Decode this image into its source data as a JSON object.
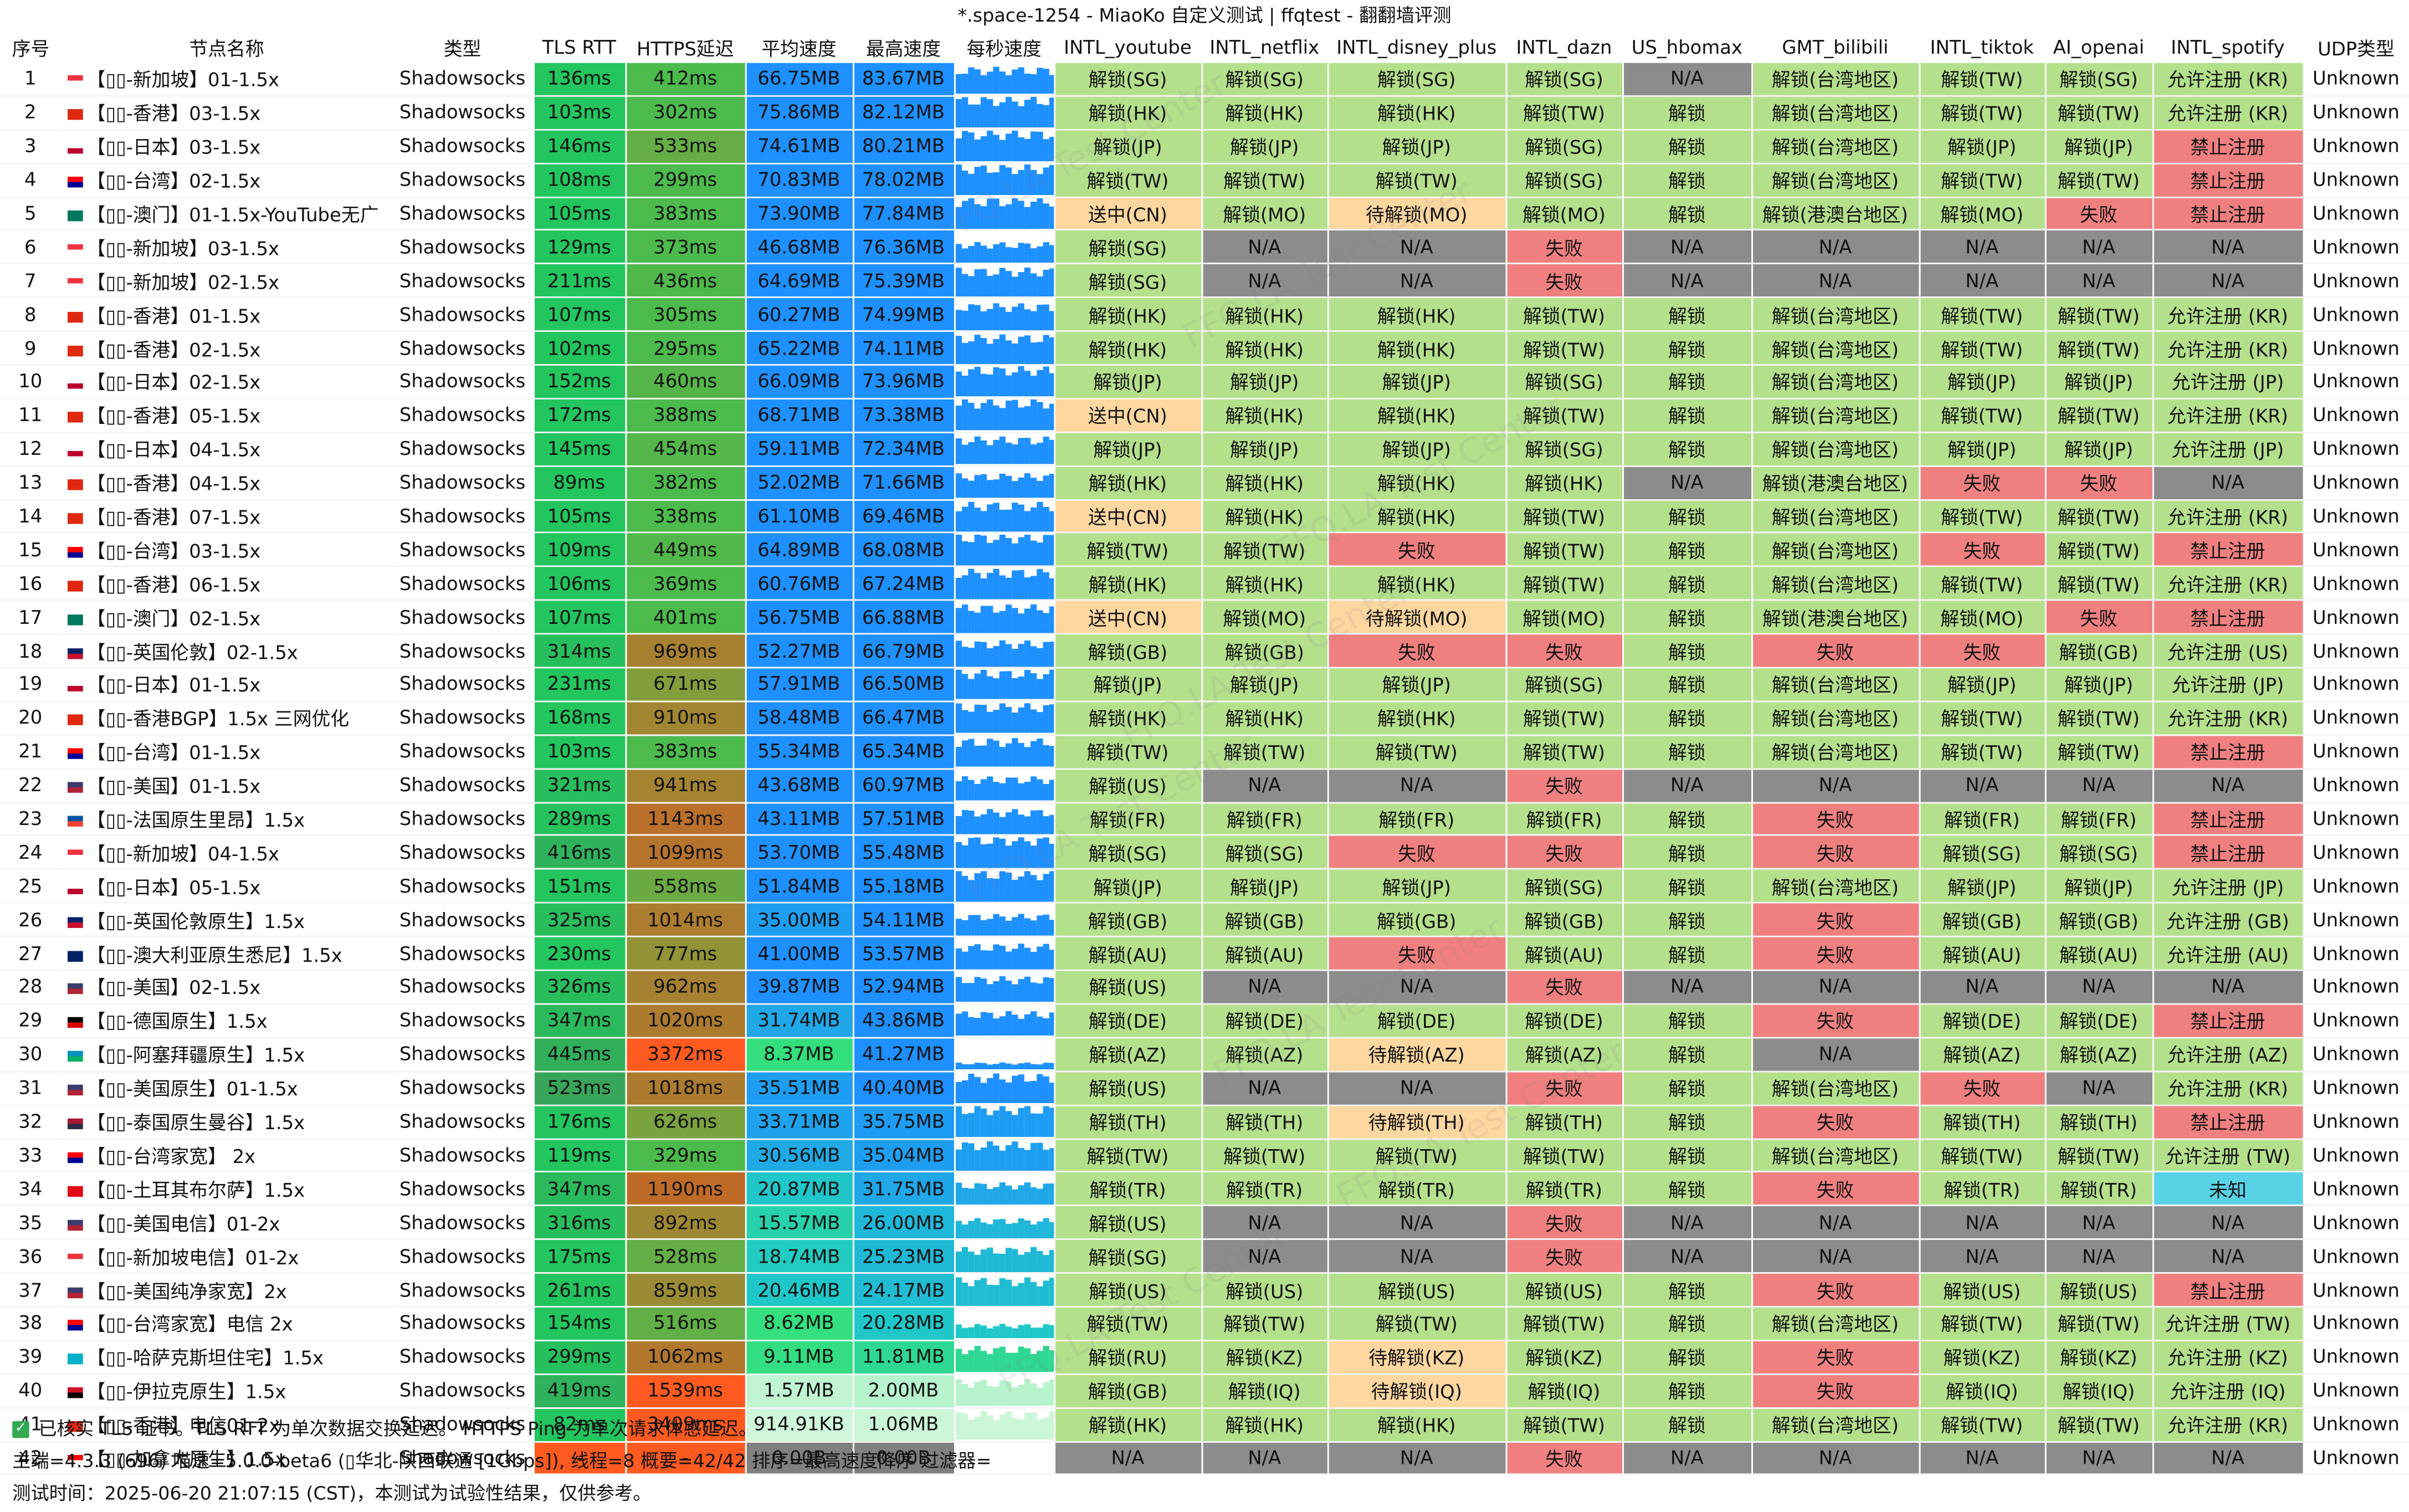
{
  "title": "*.space-1254 - MiaoKo 自定义测试 | ffqtest - 翻翻墙评测",
  "headers": [
    "序号",
    "节点名称",
    "类型",
    "TLS RTT",
    "HTTPS延迟",
    "平均速度",
    "最高速度",
    "每秒速度",
    "INTL_youtube",
    "INTL_netflix",
    "INTL_disney_plus",
    "INTL_dazn",
    "US_hbomax",
    "GMT_bilibili",
    "INTL_tiktok",
    "AI_openai",
    "INTL_spotify",
    "UDP类型"
  ],
  "watermark": "FFQ.LA Test Center",
  "rows": [
    {
      "n": "1",
      "flag": "sg",
      "name": "【▯▯-新加坡】01-1.5x",
      "type": "Shadowsocks",
      "tls": "136ms",
      "https": "412ms",
      "avg": "66.75MB",
      "max": "83.67MB",
      "yt": "解锁(SG)",
      "nf": "解锁(SG)",
      "dp": "解锁(SG)",
      "dz": "解锁(SG)",
      "hbo": "N/A",
      "bili": "解锁(台湾地区)",
      "tt": "解锁(TW)",
      "ai": "解锁(SG)",
      "sp": "允许注册 (KR)",
      "udp": "Unknown"
    },
    {
      "n": "2",
      "flag": "hk",
      "name": "【▯▯-香港】03-1.5x",
      "type": "Shadowsocks",
      "tls": "103ms",
      "https": "302ms",
      "avg": "75.86MB",
      "max": "82.12MB",
      "yt": "解锁(HK)",
      "nf": "解锁(HK)",
      "dp": "解锁(HK)",
      "dz": "解锁(TW)",
      "hbo": "解锁",
      "bili": "解锁(台湾地区)",
      "tt": "解锁(TW)",
      "ai": "解锁(TW)",
      "sp": "允许注册 (KR)",
      "udp": "Unknown"
    },
    {
      "n": "3",
      "flag": "jp",
      "name": "【▯▯-日本】03-1.5x",
      "type": "Shadowsocks",
      "tls": "146ms",
      "https": "533ms",
      "avg": "74.61MB",
      "max": "80.21MB",
      "yt": "解锁(JP)",
      "nf": "解锁(JP)",
      "dp": "解锁(JP)",
      "dz": "解锁(SG)",
      "hbo": "解锁",
      "bili": "解锁(台湾地区)",
      "tt": "解锁(JP)",
      "ai": "解锁(JP)",
      "sp": "禁止注册",
      "udp": "Unknown"
    },
    {
      "n": "4",
      "flag": "tw",
      "name": "【▯▯-台湾】02-1.5x",
      "type": "Shadowsocks",
      "tls": "108ms",
      "https": "299ms",
      "avg": "70.83MB",
      "max": "78.02MB",
      "yt": "解锁(TW)",
      "nf": "解锁(TW)",
      "dp": "解锁(TW)",
      "dz": "解锁(SG)",
      "hbo": "解锁",
      "bili": "解锁(台湾地区)",
      "tt": "解锁(TW)",
      "ai": "解锁(TW)",
      "sp": "禁止注册",
      "udp": "Unknown"
    },
    {
      "n": "5",
      "flag": "mo",
      "name": "【▯▯-澳门】01-1.5x-YouTube无广",
      "type": "Shadowsocks",
      "tls": "105ms",
      "https": "383ms",
      "avg": "73.90MB",
      "max": "77.84MB",
      "yt": "送中(CN)",
      "nf": "解锁(MO)",
      "dp": "待解锁(MO)",
      "dz": "解锁(MO)",
      "hbo": "解锁",
      "bili": "解锁(港澳台地区)",
      "tt": "解锁(MO)",
      "ai": "失败",
      "sp": "禁止注册",
      "udp": "Unknown"
    },
    {
      "n": "6",
      "flag": "sg",
      "name": "【▯▯-新加坡】03-1.5x",
      "type": "Shadowsocks",
      "tls": "129ms",
      "https": "373ms",
      "avg": "46.68MB",
      "max": "76.36MB",
      "yt": "解锁(SG)",
      "nf": "N/A",
      "dp": "N/A",
      "dz": "失败",
      "hbo": "N/A",
      "bili": "N/A",
      "tt": "N/A",
      "ai": "N/A",
      "sp": "N/A",
      "udp": "Unknown"
    },
    {
      "n": "7",
      "flag": "sg",
      "name": "【▯▯-新加坡】02-1.5x",
      "type": "Shadowsocks",
      "tls": "211ms",
      "https": "436ms",
      "avg": "64.69MB",
      "max": "75.39MB",
      "yt": "解锁(SG)",
      "nf": "N/A",
      "dp": "N/A",
      "dz": "失败",
      "hbo": "N/A",
      "bili": "N/A",
      "tt": "N/A",
      "ai": "N/A",
      "sp": "N/A",
      "udp": "Unknown"
    },
    {
      "n": "8",
      "flag": "hk",
      "name": "【▯▯-香港】01-1.5x",
      "type": "Shadowsocks",
      "tls": "107ms",
      "https": "305ms",
      "avg": "60.27MB",
      "max": "74.99MB",
      "yt": "解锁(HK)",
      "nf": "解锁(HK)",
      "dp": "解锁(HK)",
      "dz": "解锁(TW)",
      "hbo": "解锁",
      "bili": "解锁(台湾地区)",
      "tt": "解锁(TW)",
      "ai": "解锁(TW)",
      "sp": "允许注册 (KR)",
      "udp": "Unknown"
    },
    {
      "n": "9",
      "flag": "hk",
      "name": "【▯▯-香港】02-1.5x",
      "type": "Shadowsocks",
      "tls": "102ms",
      "https": "295ms",
      "avg": "65.22MB",
      "max": "74.11MB",
      "yt": "解锁(HK)",
      "nf": "解锁(HK)",
      "dp": "解锁(HK)",
      "dz": "解锁(TW)",
      "hbo": "解锁",
      "bili": "解锁(台湾地区)",
      "tt": "解锁(TW)",
      "ai": "解锁(TW)",
      "sp": "允许注册 (KR)",
      "udp": "Unknown"
    },
    {
      "n": "10",
      "flag": "jp",
      "name": "【▯▯-日本】02-1.5x",
      "type": "Shadowsocks",
      "tls": "152ms",
      "https": "460ms",
      "avg": "66.09MB",
      "max": "73.96MB",
      "yt": "解锁(JP)",
      "nf": "解锁(JP)",
      "dp": "解锁(JP)",
      "dz": "解锁(SG)",
      "hbo": "解锁",
      "bili": "解锁(台湾地区)",
      "tt": "解锁(JP)",
      "ai": "解锁(JP)",
      "sp": "允许注册 (JP)",
      "udp": "Unknown"
    },
    {
      "n": "11",
      "flag": "hk",
      "name": "【▯▯-香港】05-1.5x",
      "type": "Shadowsocks",
      "tls": "172ms",
      "https": "388ms",
      "avg": "68.71MB",
      "max": "73.38MB",
      "yt": "送中(CN)",
      "nf": "解锁(HK)",
      "dp": "解锁(HK)",
      "dz": "解锁(TW)",
      "hbo": "解锁",
      "bili": "解锁(台湾地区)",
      "tt": "解锁(TW)",
      "ai": "解锁(TW)",
      "sp": "允许注册 (KR)",
      "udp": "Unknown"
    },
    {
      "n": "12",
      "flag": "jp",
      "name": "【▯▯-日本】04-1.5x",
      "type": "Shadowsocks",
      "tls": "145ms",
      "https": "454ms",
      "avg": "59.11MB",
      "max": "72.34MB",
      "yt": "解锁(JP)",
      "nf": "解锁(JP)",
      "dp": "解锁(JP)",
      "dz": "解锁(SG)",
      "hbo": "解锁",
      "bili": "解锁(台湾地区)",
      "tt": "解锁(JP)",
      "ai": "解锁(JP)",
      "sp": "允许注册 (JP)",
      "udp": "Unknown"
    },
    {
      "n": "13",
      "flag": "hk",
      "name": "【▯▯-香港】04-1.5x",
      "type": "Shadowsocks",
      "tls": "89ms",
      "https": "382ms",
      "avg": "52.02MB",
      "max": "71.66MB",
      "yt": "解锁(HK)",
      "nf": "解锁(HK)",
      "dp": "解锁(HK)",
      "dz": "解锁(HK)",
      "hbo": "N/A",
      "bili": "解锁(港澳台地区)",
      "tt": "失败",
      "ai": "失败",
      "sp": "N/A",
      "udp": "Unknown"
    },
    {
      "n": "14",
      "flag": "hk",
      "name": "【▯▯-香港】07-1.5x",
      "type": "Shadowsocks",
      "tls": "105ms",
      "https": "338ms",
      "avg": "61.10MB",
      "max": "69.46MB",
      "yt": "送中(CN)",
      "nf": "解锁(HK)",
      "dp": "解锁(HK)",
      "dz": "解锁(TW)",
      "hbo": "解锁",
      "bili": "解锁(台湾地区)",
      "tt": "解锁(TW)",
      "ai": "解锁(TW)",
      "sp": "允许注册 (KR)",
      "udp": "Unknown"
    },
    {
      "n": "15",
      "flag": "tw",
      "name": "【▯▯-台湾】03-1.5x",
      "type": "Shadowsocks",
      "tls": "109ms",
      "https": "449ms",
      "avg": "64.89MB",
      "max": "68.08MB",
      "yt": "解锁(TW)",
      "nf": "解锁(TW)",
      "dp": "失败",
      "dz": "解锁(TW)",
      "hbo": "解锁",
      "bili": "解锁(台湾地区)",
      "tt": "失败",
      "ai": "解锁(TW)",
      "sp": "禁止注册",
      "udp": "Unknown"
    },
    {
      "n": "16",
      "flag": "hk",
      "name": "【▯▯-香港】06-1.5x",
      "type": "Shadowsocks",
      "tls": "106ms",
      "https": "369ms",
      "avg": "60.76MB",
      "max": "67.24MB",
      "yt": "解锁(HK)",
      "nf": "解锁(HK)",
      "dp": "解锁(HK)",
      "dz": "解锁(TW)",
      "hbo": "解锁",
      "bili": "解锁(台湾地区)",
      "tt": "解锁(TW)",
      "ai": "解锁(TW)",
      "sp": "允许注册 (KR)",
      "udp": "Unknown"
    },
    {
      "n": "17",
      "flag": "mo",
      "name": "【▯▯-澳门】02-1.5x",
      "type": "Shadowsocks",
      "tls": "107ms",
      "https": "401ms",
      "avg": "56.75MB",
      "max": "66.88MB",
      "yt": "送中(CN)",
      "nf": "解锁(MO)",
      "dp": "待解锁(MO)",
      "dz": "解锁(MO)",
      "hbo": "解锁",
      "bili": "解锁(港澳台地区)",
      "tt": "解锁(MO)",
      "ai": "失败",
      "sp": "禁止注册",
      "udp": "Unknown"
    },
    {
      "n": "18",
      "flag": "gb",
      "name": "【▯▯-英国伦敦】02-1.5x",
      "type": "Shadowsocks",
      "tls": "314ms",
      "https": "969ms",
      "avg": "52.27MB",
      "max": "66.79MB",
      "yt": "解锁(GB)",
      "nf": "解锁(GB)",
      "dp": "失败",
      "dz": "失败",
      "hbo": "解锁",
      "bili": "失败",
      "tt": "失败",
      "ai": "解锁(GB)",
      "sp": "允许注册 (US)",
      "udp": "Unknown"
    },
    {
      "n": "19",
      "flag": "jp",
      "name": "【▯▯-日本】01-1.5x",
      "type": "Shadowsocks",
      "tls": "231ms",
      "https": "671ms",
      "avg": "57.91MB",
      "max": "66.50MB",
      "yt": "解锁(JP)",
      "nf": "解锁(JP)",
      "dp": "解锁(JP)",
      "dz": "解锁(SG)",
      "hbo": "解锁",
      "bili": "解锁(台湾地区)",
      "tt": "解锁(JP)",
      "ai": "解锁(JP)",
      "sp": "允许注册 (JP)",
      "udp": "Unknown"
    },
    {
      "n": "20",
      "flag": "hk",
      "name": "【▯▯-香港BGP】1.5x 三网优化",
      "type": "Shadowsocks",
      "tls": "168ms",
      "https": "910ms",
      "avg": "58.48MB",
      "max": "66.47MB",
      "yt": "解锁(HK)",
      "nf": "解锁(HK)",
      "dp": "解锁(HK)",
      "dz": "解锁(TW)",
      "hbo": "解锁",
      "bili": "解锁(台湾地区)",
      "tt": "解锁(TW)",
      "ai": "解锁(TW)",
      "sp": "允许注册 (KR)",
      "udp": "Unknown"
    },
    {
      "n": "21",
      "flag": "tw",
      "name": "【▯▯-台湾】01-1.5x",
      "type": "Shadowsocks",
      "tls": "103ms",
      "https": "383ms",
      "avg": "55.34MB",
      "max": "65.34MB",
      "yt": "解锁(TW)",
      "nf": "解锁(TW)",
      "dp": "解锁(TW)",
      "dz": "解锁(TW)",
      "hbo": "解锁",
      "bili": "解锁(台湾地区)",
      "tt": "解锁(TW)",
      "ai": "解锁(TW)",
      "sp": "禁止注册",
      "udp": "Unknown"
    },
    {
      "n": "22",
      "flag": "us",
      "name": "【▯▯-美国】01-1.5x",
      "type": "Shadowsocks",
      "tls": "321ms",
      "https": "941ms",
      "avg": "43.68MB",
      "max": "60.97MB",
      "yt": "解锁(US)",
      "nf": "N/A",
      "dp": "N/A",
      "dz": "失败",
      "hbo": "N/A",
      "bili": "N/A",
      "tt": "N/A",
      "ai": "N/A",
      "sp": "N/A",
      "udp": "Unknown"
    },
    {
      "n": "23",
      "flag": "fr",
      "name": "【▯▯-法国原生里昂】1.5x",
      "type": "Shadowsocks",
      "tls": "289ms",
      "https": "1143ms",
      "avg": "43.11MB",
      "max": "57.51MB",
      "yt": "解锁(FR)",
      "nf": "解锁(FR)",
      "dp": "解锁(FR)",
      "dz": "解锁(FR)",
      "hbo": "解锁",
      "bili": "失败",
      "tt": "解锁(FR)",
      "ai": "解锁(FR)",
      "sp": "禁止注册",
      "udp": "Unknown"
    },
    {
      "n": "24",
      "flag": "sg",
      "name": "【▯▯-新加坡】04-1.5x",
      "type": "Shadowsocks",
      "tls": "416ms",
      "https": "1099ms",
      "avg": "53.70MB",
      "max": "55.48MB",
      "yt": "解锁(SG)",
      "nf": "解锁(SG)",
      "dp": "失败",
      "dz": "失败",
      "hbo": "解锁",
      "bili": "失败",
      "tt": "解锁(SG)",
      "ai": "解锁(SG)",
      "sp": "禁止注册",
      "udp": "Unknown"
    },
    {
      "n": "25",
      "flag": "jp",
      "name": "【▯▯-日本】05-1.5x",
      "type": "Shadowsocks",
      "tls": "151ms",
      "https": "558ms",
      "avg": "51.84MB",
      "max": "55.18MB",
      "yt": "解锁(JP)",
      "nf": "解锁(JP)",
      "dp": "解锁(JP)",
      "dz": "解锁(SG)",
      "hbo": "解锁",
      "bili": "解锁(台湾地区)",
      "tt": "解锁(JP)",
      "ai": "解锁(JP)",
      "sp": "允许注册 (JP)",
      "udp": "Unknown"
    },
    {
      "n": "26",
      "flag": "gb",
      "name": "【▯▯-英国伦敦原生】1.5x",
      "type": "Shadowsocks",
      "tls": "325ms",
      "https": "1014ms",
      "avg": "35.00MB",
      "max": "54.11MB",
      "yt": "解锁(GB)",
      "nf": "解锁(GB)",
      "dp": "解锁(GB)",
      "dz": "解锁(GB)",
      "hbo": "解锁",
      "bili": "失败",
      "tt": "解锁(GB)",
      "ai": "解锁(GB)",
      "sp": "允许注册 (GB)",
      "udp": "Unknown"
    },
    {
      "n": "27",
      "flag": "au",
      "name": "【▯▯-澳大利亚原生悉尼】1.5x",
      "type": "Shadowsocks",
      "tls": "230ms",
      "https": "777ms",
      "avg": "41.00MB",
      "max": "53.57MB",
      "yt": "解锁(AU)",
      "nf": "解锁(AU)",
      "dp": "失败",
      "dz": "解锁(AU)",
      "hbo": "解锁",
      "bili": "失败",
      "tt": "解锁(AU)",
      "ai": "解锁(AU)",
      "sp": "允许注册 (AU)",
      "udp": "Unknown"
    },
    {
      "n": "28",
      "flag": "us",
      "name": "【▯▯-美国】02-1.5x",
      "type": "Shadowsocks",
      "tls": "326ms",
      "https": "962ms",
      "avg": "39.87MB",
      "max": "52.94MB",
      "yt": "解锁(US)",
      "nf": "N/A",
      "dp": "N/A",
      "dz": "失败",
      "hbo": "N/A",
      "bili": "N/A",
      "tt": "N/A",
      "ai": "N/A",
      "sp": "N/A",
      "udp": "Unknown"
    },
    {
      "n": "29",
      "flag": "de",
      "name": "【▯▯-德国原生】1.5x",
      "type": "Shadowsocks",
      "tls": "347ms",
      "https": "1020ms",
      "avg": "31.74MB",
      "max": "43.86MB",
      "yt": "解锁(DE)",
      "nf": "解锁(DE)",
      "dp": "解锁(DE)",
      "dz": "解锁(DE)",
      "hbo": "解锁",
      "bili": "失败",
      "tt": "解锁(DE)",
      "ai": "解锁(DE)",
      "sp": "禁止注册",
      "udp": "Unknown"
    },
    {
      "n": "30",
      "flag": "az",
      "name": "【▯▯-阿塞拜疆原生】1.5x",
      "type": "Shadowsocks",
      "tls": "445ms",
      "https": "3372ms",
      "avg": "8.37MB",
      "max": "41.27MB",
      "yt": "解锁(AZ)",
      "nf": "解锁(AZ)",
      "dp": "待解锁(AZ)",
      "dz": "解锁(AZ)",
      "hbo": "解锁",
      "bili": "N/A",
      "tt": "解锁(AZ)",
      "ai": "解锁(AZ)",
      "sp": "允许注册 (AZ)",
      "udp": "Unknown"
    },
    {
      "n": "31",
      "flag": "us",
      "name": "【▯▯-美国原生】01-1.5x",
      "type": "Shadowsocks",
      "tls": "523ms",
      "https": "1018ms",
      "avg": "35.51MB",
      "max": "40.40MB",
      "yt": "解锁(US)",
      "nf": "N/A",
      "dp": "N/A",
      "dz": "失败",
      "hbo": "解锁",
      "bili": "解锁(台湾地区)",
      "tt": "失败",
      "ai": "N/A",
      "sp": "允许注册 (KR)",
      "udp": "Unknown"
    },
    {
      "n": "32",
      "flag": "th",
      "name": "【▯▯-泰国原生曼谷】1.5x",
      "type": "Shadowsocks",
      "tls": "176ms",
      "https": "626ms",
      "avg": "33.71MB",
      "max": "35.75MB",
      "yt": "解锁(TH)",
      "nf": "解锁(TH)",
      "dp": "待解锁(TH)",
      "dz": "解锁(TH)",
      "hbo": "解锁",
      "bili": "失败",
      "tt": "解锁(TH)",
      "ai": "解锁(TH)",
      "sp": "禁止注册",
      "udp": "Unknown"
    },
    {
      "n": "33",
      "flag": "tw",
      "name": "【▯▯-台湾家宽】 2x",
      "type": "Shadowsocks",
      "tls": "119ms",
      "https": "329ms",
      "avg": "30.56MB",
      "max": "35.04MB",
      "yt": "解锁(TW)",
      "nf": "解锁(TW)",
      "dp": "解锁(TW)",
      "dz": "解锁(TW)",
      "hbo": "解锁",
      "bili": "解锁(台湾地区)",
      "tt": "解锁(TW)",
      "ai": "解锁(TW)",
      "sp": "允许注册 (TW)",
      "udp": "Unknown"
    },
    {
      "n": "34",
      "flag": "tr",
      "name": "【▯▯-土耳其布尔萨】1.5x",
      "type": "Shadowsocks",
      "tls": "347ms",
      "https": "1190ms",
      "avg": "20.87MB",
      "max": "31.75MB",
      "yt": "解锁(TR)",
      "nf": "解锁(TR)",
      "dp": "解锁(TR)",
      "dz": "解锁(TR)",
      "hbo": "解锁",
      "bili": "失败",
      "tt": "解锁(TR)",
      "ai": "解锁(TR)",
      "sp": "未知",
      "udp": "Unknown"
    },
    {
      "n": "35",
      "flag": "us",
      "name": "【▯▯-美国电信】01-2x",
      "type": "Shadowsocks",
      "tls": "316ms",
      "https": "892ms",
      "avg": "15.57MB",
      "max": "26.00MB",
      "yt": "解锁(US)",
      "nf": "N/A",
      "dp": "N/A",
      "dz": "失败",
      "hbo": "N/A",
      "bili": "N/A",
      "tt": "N/A",
      "ai": "N/A",
      "sp": "N/A",
      "udp": "Unknown"
    },
    {
      "n": "36",
      "flag": "sg",
      "name": "【▯▯-新加坡电信】01-2x",
      "type": "Shadowsocks",
      "tls": "175ms",
      "https": "528ms",
      "avg": "18.74MB",
      "max": "25.23MB",
      "yt": "解锁(SG)",
      "nf": "N/A",
      "dp": "N/A",
      "dz": "失败",
      "hbo": "N/A",
      "bili": "N/A",
      "tt": "N/A",
      "ai": "N/A",
      "sp": "N/A",
      "udp": "Unknown"
    },
    {
      "n": "37",
      "flag": "us",
      "name": "【▯▯-美国纯净家宽】2x",
      "type": "Shadowsocks",
      "tls": "261ms",
      "https": "859ms",
      "avg": "20.46MB",
      "max": "24.17MB",
      "yt": "解锁(US)",
      "nf": "解锁(US)",
      "dp": "解锁(US)",
      "dz": "解锁(US)",
      "hbo": "解锁",
      "bili": "失败",
      "tt": "解锁(US)",
      "ai": "解锁(US)",
      "sp": "禁止注册",
      "udp": "Unknown"
    },
    {
      "n": "38",
      "flag": "tw",
      "name": "【▯▯-台湾家宽】电信 2x",
      "type": "Shadowsocks",
      "tls": "154ms",
      "https": "516ms",
      "avg": "8.62MB",
      "max": "20.28MB",
      "yt": "解锁(TW)",
      "nf": "解锁(TW)",
      "dp": "解锁(TW)",
      "dz": "解锁(TW)",
      "hbo": "解锁",
      "bili": "解锁(台湾地区)",
      "tt": "解锁(TW)",
      "ai": "解锁(TW)",
      "sp": "允许注册 (TW)",
      "udp": "Unknown"
    },
    {
      "n": "39",
      "flag": "kz",
      "name": "【▯▯-哈萨克斯坦住宅】1.5x",
      "type": "Shadowsocks",
      "tls": "299ms",
      "https": "1062ms",
      "avg": "9.11MB",
      "max": "11.81MB",
      "yt": "解锁(RU)",
      "nf": "解锁(KZ)",
      "dp": "待解锁(KZ)",
      "dz": "解锁(KZ)",
      "hbo": "解锁",
      "bili": "失败",
      "tt": "解锁(KZ)",
      "ai": "解锁(KZ)",
      "sp": "允许注册 (KZ)",
      "udp": "Unknown"
    },
    {
      "n": "40",
      "flag": "iq",
      "name": "【▯▯-伊拉克原生】1.5x",
      "type": "Shadowsocks",
      "tls": "419ms",
      "https": "1539ms",
      "avg": "1.57MB",
      "max": "2.00MB",
      "yt": "解锁(GB)",
      "nf": "解锁(IQ)",
      "dp": "待解锁(IQ)",
      "dz": "解锁(IQ)",
      "hbo": "解锁",
      "bili": "失败",
      "tt": "解锁(IQ)",
      "ai": "解锁(IQ)",
      "sp": "允许注册 (IQ)",
      "udp": "Unknown"
    },
    {
      "n": "41",
      "flag": "hk",
      "name": "【▯▯-香港】电信01-2x",
      "type": "Shadowsocks",
      "tls": "82ms",
      "https": "3409ms",
      "avg": "914.91KB",
      "max": "1.06MB",
      "yt": "解锁(HK)",
      "nf": "解锁(HK)",
      "dp": "解锁(HK)",
      "dz": "解锁(TW)",
      "hbo": "解锁",
      "bili": "解锁(台湾地区)",
      "tt": "解锁(TW)",
      "ai": "解锁(TW)",
      "sp": "允许注册 (KR)",
      "udp": "Unknown"
    },
    {
      "n": "42",
      "flag": "ca",
      "name": "【▯▯-加拿大原生】1.5x",
      "type": "Shadowsocks",
      "tls": "-",
      "https": "-",
      "avg": "0.00B",
      "max": "0.00B",
      "yt": "N/A",
      "nf": "N/A",
      "dp": "N/A",
      "dz": "失败",
      "hbo": "N/A",
      "bili": "N/A",
      "tt": "N/A",
      "ai": "N/A",
      "sp": "N/A",
      "udp": "Unknown"
    }
  ],
  "footer": {
    "line1": "已核实 TLS 证书。TLS RTT 为单次数据交换延迟。 HTTPS Ping 为单次请求体感延迟。",
    "line2": "主端=4.3.3 (696) 喵速=5.0.0-beta6 (▯华北-陕西联通 [1Gbps]), 线程=8 概要=42/42 排序=最高速度降序 过滤器=",
    "line3": "测试时间：2025-06-20 21:07:15 (CST)，本测试为试验性结果，仅供参考。"
  },
  "colors": {
    "unlock": "#b4e08c",
    "na": "#8c8c8c",
    "fail": "#f08080",
    "pending": "#fdd7a0",
    "cn": "#fdd7a0",
    "unknown": "#5ad2e6",
    "tls": "#22c55e",
    "speed_hi": "#1e90ff",
    "speed_lo": "#ffffff"
  }
}
